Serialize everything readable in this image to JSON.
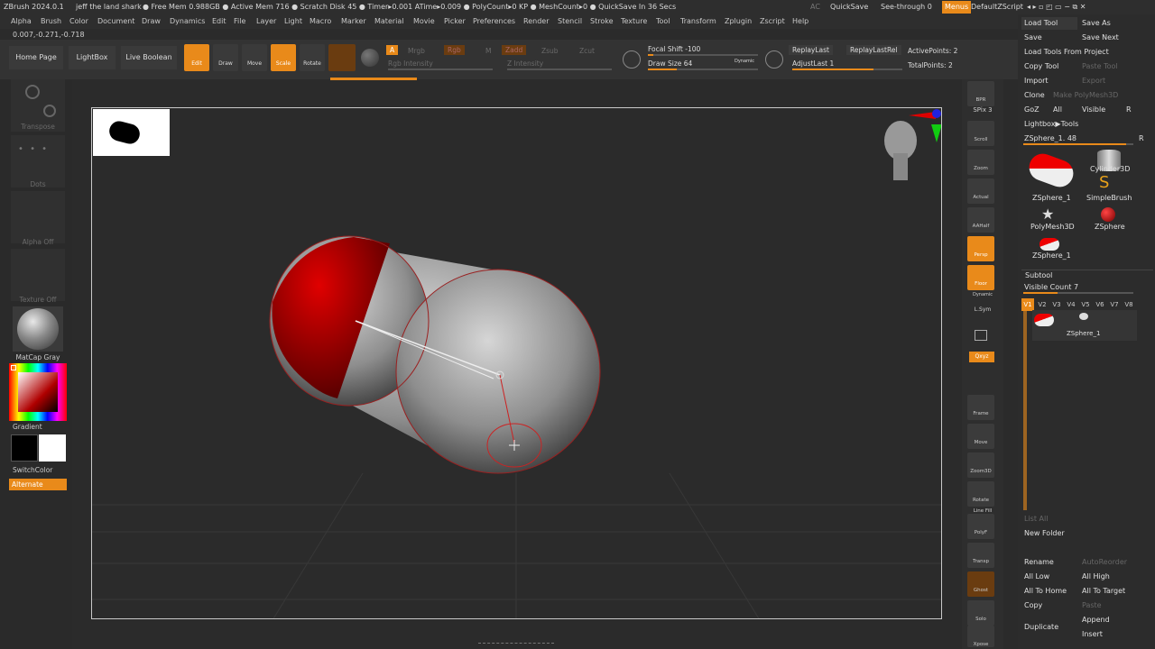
{
  "titlebar": {
    "app": "ZBrush 2024.0.1",
    "doc": "jeff the land shark",
    "stats": "● Free Mem 0.988GB ● Active Mem 716 ● Scratch Disk 45 ● Timer▸0.001 ATime▸0.009 ● PolyCount▸0 KP ● MeshCount▸0 ● QuickSave In 36 Secs",
    "ac": "AC",
    "quicksave": "QuickSave",
    "seethrough": "See-through  0",
    "menus": "Menus",
    "script": "DefaultZScript"
  },
  "menu": [
    "Alpha",
    "Brush",
    "Color",
    "Document",
    "Draw",
    "Dynamics",
    "Edit",
    "File",
    "Layer",
    "Light",
    "Macro",
    "Marker",
    "Material",
    "Movie",
    "Picker",
    "Preferences",
    "Render",
    "Stencil",
    "Stroke",
    "Texture",
    "Tool",
    "Transform",
    "Zplugin",
    "Zscript",
    "Help"
  ],
  "coords": "0.007,-0.271,-0.718",
  "shelf": {
    "home": "Home Page",
    "lightbox": "LightBox",
    "liveboolean": "Live Boolean"
  },
  "tools": {
    "edit": "Edit",
    "draw": "Draw",
    "move": "Move",
    "scale": "Scale",
    "rotate": "Rotate"
  },
  "brushctl": {
    "a": "A",
    "mrgb": "Mrgb",
    "rgb": "Rgb",
    "m": "M",
    "zadd": "Zadd",
    "zsub": "Zsub",
    "zcut": "Zcut",
    "rgb_intensity": "Rgb Intensity",
    "z_intensity": "Z Intensity"
  },
  "focal_shift": "Focal Shift -100",
  "draw_size": "Draw Size 64",
  "dynamic": "Dynamic",
  "replay": {
    "last": "ReplayLast",
    "lastrel": "ReplayLastRel",
    "adjust": "AdjustLast 1"
  },
  "points": {
    "active": "ActivePoints: 2",
    "total": "TotalPoints: 2"
  },
  "lefttray": {
    "transpose": "Transpose",
    "dots": "Dots",
    "alpha": "Alpha Off",
    "texture": "Texture Off",
    "matcap": "MatCap Gray",
    "gradient": "Gradient",
    "switchcolor": "SwitchColor",
    "alternate": "Alternate"
  },
  "righttray": {
    "bpr": "BPR",
    "spix": "SPix 3",
    "scroll": "Scroll",
    "zoom": "Zoom",
    "actual": "Actual",
    "aahalf": "AAHalf",
    "persp": "Persp",
    "floor": "Floor",
    "dynamic": "Dynamic",
    "lsym": "L.Sym",
    "qxyz": "Qxyz",
    "frame": "Frame",
    "move": "Move",
    "zoom3d": "Zoom3D",
    "rotate": "Rotate",
    "linefill": "Line Fill",
    "polyf": "PolyF",
    "transp": "Transp",
    "ghost": "Ghost",
    "solo": "Solo",
    "xpose": "Xpose"
  },
  "rightpanel": {
    "loadtool": "Load Tool",
    "saveas": "Save As",
    "save": "Save",
    "savenext": "Save Next",
    "loadproject": "Load Tools From Project",
    "copytool": "Copy Tool",
    "pastetool": "Paste Tool",
    "import": "Import",
    "export": "Export",
    "clone": "Clone",
    "makepoly": "Make PolyMesh3D",
    "goz": "GoZ",
    "all": "All",
    "visible": "Visible",
    "r": "R",
    "lightboxtools": "Lightbox▶Tools",
    "zsphere": "ZSphere_1. 48",
    "items": [
      "ZSphere_1",
      "Cylinder3D",
      "SimpleBrush",
      "PolyMesh3D",
      "ZSphere",
      "ZSphere_1"
    ],
    "subtool": "Subtool",
    "visiblecount": "Visible Count 7",
    "v": [
      "V1",
      "V2",
      "V3",
      "V4",
      "V5",
      "V6",
      "V7",
      "V8"
    ],
    "subitem": "ZSphere_1",
    "listall": "List All",
    "newfolder": "New Folder",
    "rename": "Rename",
    "autoreorder": "AutoReorder",
    "alllow": "All Low",
    "allhigh": "All High",
    "alltohome": "All To Home",
    "alltotarget": "All To Target",
    "copy": "Copy",
    "paste": "Paste",
    "duplicate": "Duplicate",
    "append": "Append",
    "insert": "Insert"
  },
  "colors": {
    "accent": "#e98a1a",
    "panel": "#2c2c2c",
    "red": "#b00000"
  }
}
